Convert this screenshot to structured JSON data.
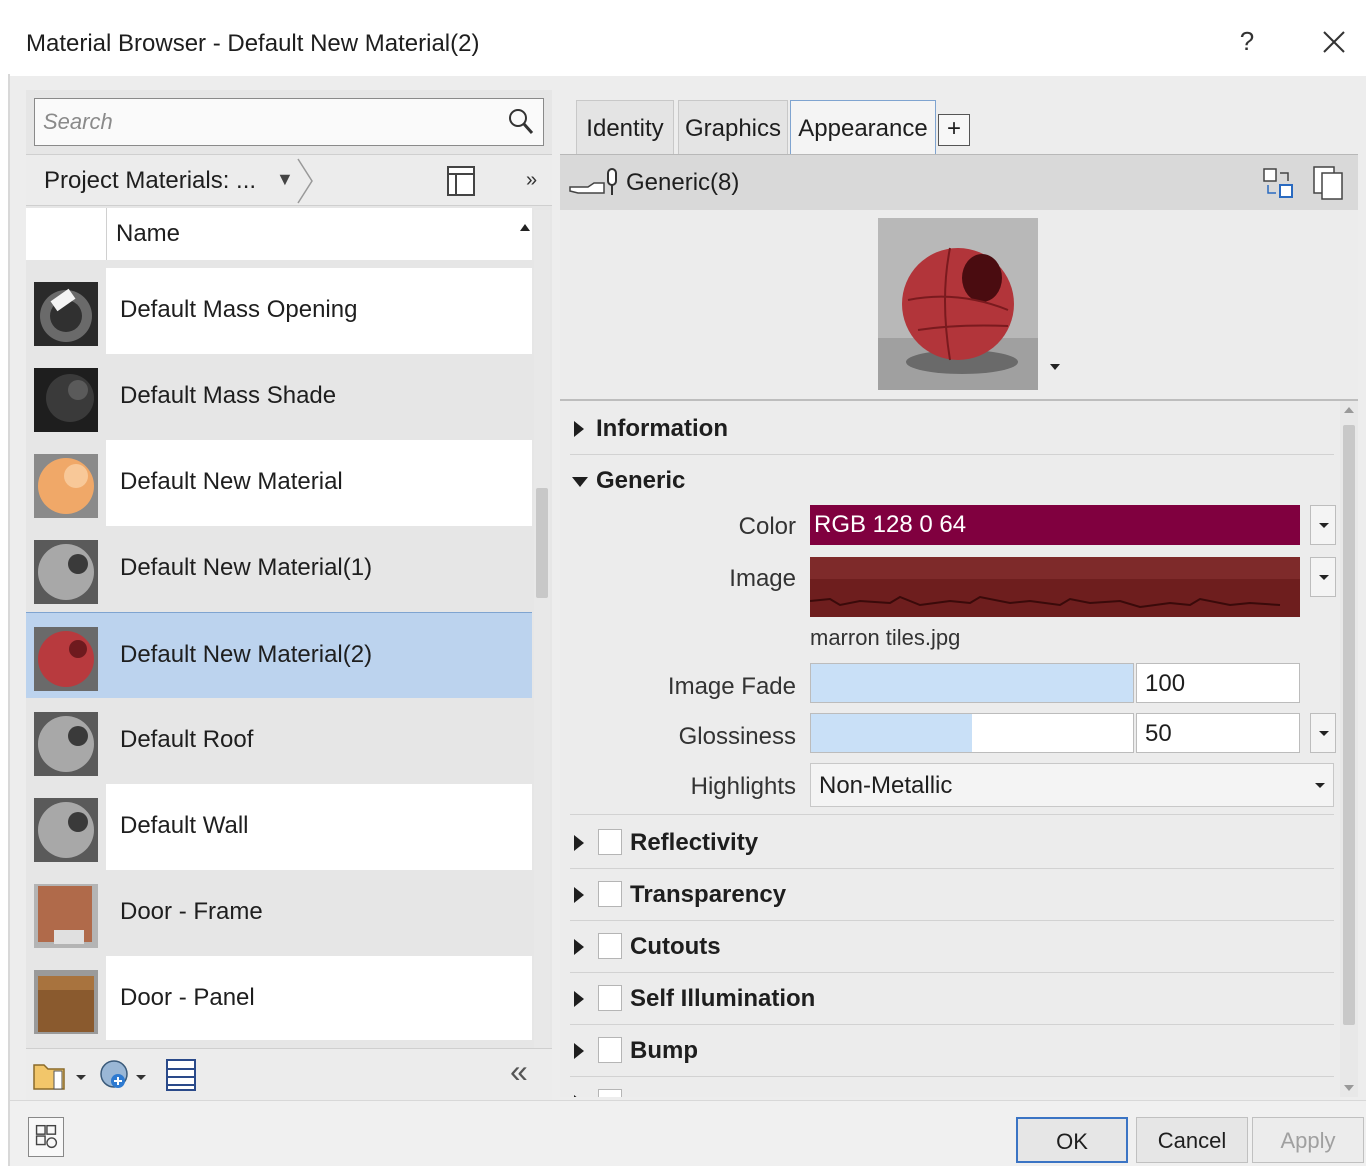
{
  "window": {
    "title": "Material Browser - Default New Material(2)",
    "help_label": "?",
    "close_icon": "close-icon"
  },
  "left_panel": {
    "search_placeholder": "Search",
    "project_selector": "Project Materials: ...",
    "more_label": "»",
    "column_name": "Name",
    "materials": [
      {
        "name": "Default Mass Opening",
        "thumb": "mass-opening",
        "selected": false
      },
      {
        "name": "Default Mass Shade",
        "thumb": "mass-shade",
        "selected": false
      },
      {
        "name": "Default New Material",
        "thumb": "orange-sphere",
        "selected": false
      },
      {
        "name": "Default New Material(1)",
        "thumb": "grey-sphere",
        "selected": false
      },
      {
        "name": "Default New Material(2)",
        "thumb": "red-sphere",
        "selected": true
      },
      {
        "name": "Default Roof",
        "thumb": "grey-sphere",
        "selected": false
      },
      {
        "name": "Default Wall",
        "thumb": "grey-sphere",
        "selected": false
      },
      {
        "name": "Door - Frame",
        "thumb": "wood-frame",
        "selected": false
      },
      {
        "name": "Door - Panel",
        "thumb": "wood-box",
        "selected": false
      }
    ],
    "collapse_label": "«"
  },
  "tabs": [
    {
      "label": "Identity",
      "active": false
    },
    {
      "label": "Graphics",
      "active": false
    },
    {
      "label": "Appearance",
      "active": true
    }
  ],
  "add_tab_label": "+",
  "asset": {
    "name": "Generic(8)"
  },
  "sections": {
    "information": "Information",
    "generic": "Generic",
    "reflectivity": "Reflectivity",
    "transparency": "Transparency",
    "cutouts": "Cutouts",
    "self_illumination": "Self Illumination",
    "bump": "Bump"
  },
  "generic": {
    "color_label": "Color",
    "color_value": "RGB 128 0 64",
    "color_hex": "#80003f",
    "image_label": "Image",
    "image_file": "marron tiles.jpg",
    "image_fade_label": "Image Fade",
    "image_fade_value": "100",
    "image_fade_fraction": 1.0,
    "glossiness_label": "Glossiness",
    "glossiness_value": "50",
    "glossiness_fraction": 0.5,
    "highlights_label": "Highlights",
    "highlights_value": "Non-Metallic"
  },
  "footer": {
    "ok": "OK",
    "cancel": "Cancel",
    "apply": "Apply"
  }
}
